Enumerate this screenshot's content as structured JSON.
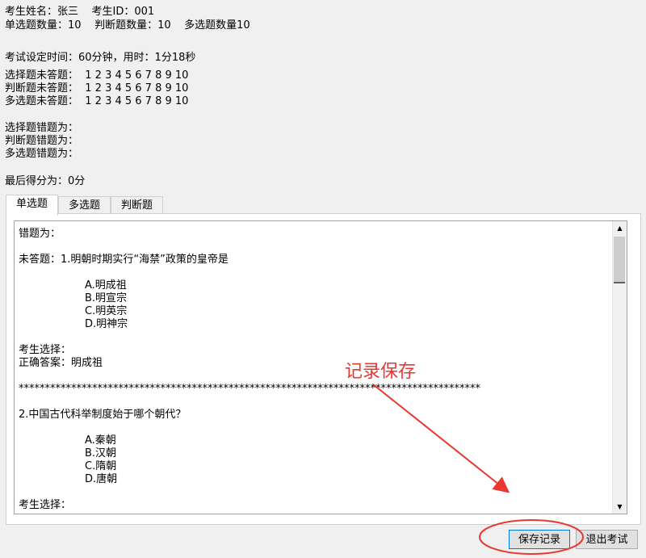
{
  "header": {
    "line1": "考生姓名：张三    考生ID：001",
    "line2": "单选题数量：10    判断题数量：10    多选题数量10",
    "time": "考试设定时间：60分钟，用时：1分18秒",
    "unanswered_choice": "选择题未答题：  1 2 3 4 5 6 7 8 9 10",
    "unanswered_judge": "判断题未答题：  1 2 3 4 5 6 7 8 9 10",
    "unanswered_multi": "多选题未答题：  1 2 3 4 5 6 7 8 9 10",
    "wrong_choice": "选择题错题为：",
    "wrong_judge": "判断题错题为：",
    "wrong_multi": "多选题错题为：",
    "final_score": "最后得分为：0分"
  },
  "tabs": [
    {
      "label": "单选题",
      "active": true
    },
    {
      "label": "多选题",
      "active": false
    },
    {
      "label": "判断题",
      "active": false
    }
  ],
  "content_lines": [
    {
      "text": "错题为：",
      "indent": false
    },
    {
      "text": "",
      "indent": false
    },
    {
      "text": "未答题：1.明朝时期实行“海禁”政策的皇帝是",
      "indent": false
    },
    {
      "text": "",
      "indent": false
    },
    {
      "text": "A.明成祖",
      "indent": true
    },
    {
      "text": "B.明宣宗",
      "indent": true
    },
    {
      "text": "C.明英宗",
      "indent": true
    },
    {
      "text": "D.明神宗",
      "indent": true
    },
    {
      "text": "",
      "indent": false
    },
    {
      "text": "考生选择：",
      "indent": false
    },
    {
      "text": "正确答案：明成祖",
      "indent": false
    },
    {
      "text": "",
      "indent": false
    },
    {
      "text": "****************************************************************************************",
      "indent": false
    },
    {
      "text": "",
      "indent": false
    },
    {
      "text": "2.中国古代科举制度始于哪个朝代？",
      "indent": false
    },
    {
      "text": "",
      "indent": false
    },
    {
      "text": "A.秦朝",
      "indent": true
    },
    {
      "text": "B.汉朝",
      "indent": true
    },
    {
      "text": "C.隋朝",
      "indent": true
    },
    {
      "text": "D.唐朝",
      "indent": true
    },
    {
      "text": "",
      "indent": false
    },
    {
      "text": "考生选择：",
      "indent": false
    }
  ],
  "annotation": {
    "text": "记录保存",
    "color": "#e8382f"
  },
  "buttons": {
    "save": "保存记录",
    "exit": "退出考试"
  },
  "icons": {
    "scroll_up": "scroll-up-arrow-icon",
    "scroll_down": "scroll-down-arrow-icon"
  }
}
